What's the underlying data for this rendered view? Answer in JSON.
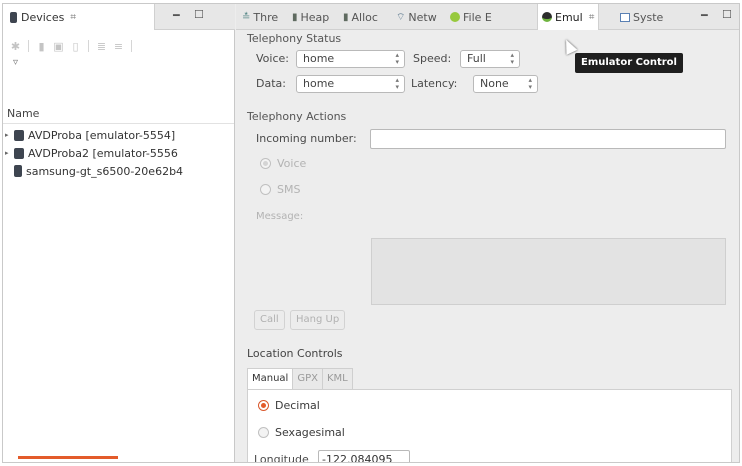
{
  "devices_view": {
    "tab_label": "Devices",
    "view_menu_glyph": "▿",
    "column_header": "Name",
    "devices": [
      {
        "label": "AVDProba [emulator-5554]",
        "type": "emulator"
      },
      {
        "label": "AVDProba2 [emulator-5556",
        "type": "emulator"
      },
      {
        "label": "samsung-gt_s6500-20e62b4",
        "type": "phone"
      }
    ],
    "toolbar_icons": [
      "debug-icon",
      "update-heap-icon",
      "dump-hprof-icon",
      "gc-icon",
      "update-threads-icon",
      "start-profiling-icon",
      "stop-process-icon"
    ]
  },
  "tabs": [
    {
      "label": "Thre",
      "icon": "threads-icon"
    },
    {
      "label": "Heap",
      "icon": "heap-icon"
    },
    {
      "label": "Alloc",
      "icon": "alloc-icon"
    },
    {
      "label": "Netw",
      "icon": "network-icon"
    },
    {
      "label": "File E",
      "icon": "file-explorer-icon"
    },
    {
      "label": "Emul",
      "icon": "emulator-icon",
      "active": true
    },
    {
      "label": "Syste",
      "icon": "system-icon"
    }
  ],
  "tooltip": "Emulator Control",
  "telephony_status": {
    "title": "Telephony Status",
    "voice_label": "Voice:",
    "voice_value": "home",
    "speed_label": "Speed:",
    "speed_value": "Full",
    "data_label": "Data:",
    "data_value": "home",
    "latency_label": "Latency:",
    "latency_value": "None"
  },
  "telephony_actions": {
    "title": "Telephony Actions",
    "incoming_label": "Incoming number:",
    "incoming_value": "",
    "voice_radio": "Voice",
    "sms_radio": "SMS",
    "message_label": "Message:",
    "call_button": "Call",
    "hangup_button": "Hang Up"
  },
  "location_controls": {
    "title": "Location Controls",
    "tabs": [
      "Manual",
      "GPX",
      "KML"
    ],
    "decimal_label": "Decimal",
    "sexagesimal_label": "Sexagesimal",
    "longitude_label": "Longitude",
    "longitude_value": "-122.084095"
  },
  "colors": {
    "accent": "#e35b2a",
    "tooltip_bg": "#1f1f1f"
  }
}
